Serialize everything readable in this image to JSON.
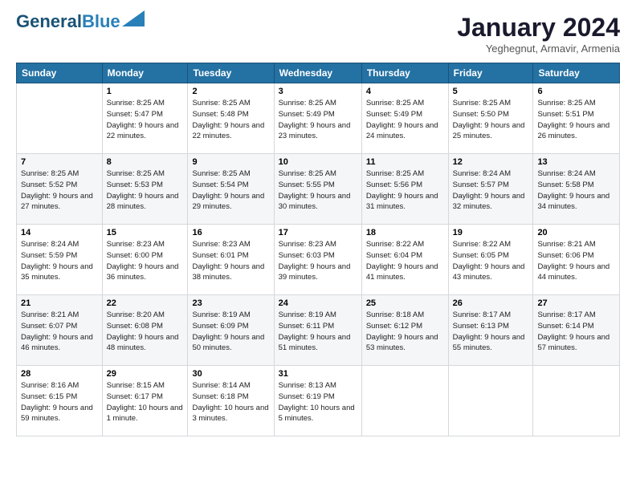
{
  "header": {
    "logo_line1": "General",
    "logo_line2": "Blue",
    "month": "January 2024",
    "location": "Yeghegnut, Armavir, Armenia"
  },
  "weekdays": [
    "Sunday",
    "Monday",
    "Tuesday",
    "Wednesday",
    "Thursday",
    "Friday",
    "Saturday"
  ],
  "weeks": [
    [
      {
        "day": "",
        "sunrise": "",
        "sunset": "",
        "daylight": ""
      },
      {
        "day": "1",
        "sunrise": "Sunrise: 8:25 AM",
        "sunset": "Sunset: 5:47 PM",
        "daylight": "Daylight: 9 hours and 22 minutes."
      },
      {
        "day": "2",
        "sunrise": "Sunrise: 8:25 AM",
        "sunset": "Sunset: 5:48 PM",
        "daylight": "Daylight: 9 hours and 22 minutes."
      },
      {
        "day": "3",
        "sunrise": "Sunrise: 8:25 AM",
        "sunset": "Sunset: 5:49 PM",
        "daylight": "Daylight: 9 hours and 23 minutes."
      },
      {
        "day": "4",
        "sunrise": "Sunrise: 8:25 AM",
        "sunset": "Sunset: 5:49 PM",
        "daylight": "Daylight: 9 hours and 24 minutes."
      },
      {
        "day": "5",
        "sunrise": "Sunrise: 8:25 AM",
        "sunset": "Sunset: 5:50 PM",
        "daylight": "Daylight: 9 hours and 25 minutes."
      },
      {
        "day": "6",
        "sunrise": "Sunrise: 8:25 AM",
        "sunset": "Sunset: 5:51 PM",
        "daylight": "Daylight: 9 hours and 26 minutes."
      }
    ],
    [
      {
        "day": "7",
        "sunrise": "Sunrise: 8:25 AM",
        "sunset": "Sunset: 5:52 PM",
        "daylight": "Daylight: 9 hours and 27 minutes."
      },
      {
        "day": "8",
        "sunrise": "Sunrise: 8:25 AM",
        "sunset": "Sunset: 5:53 PM",
        "daylight": "Daylight: 9 hours and 28 minutes."
      },
      {
        "day": "9",
        "sunrise": "Sunrise: 8:25 AM",
        "sunset": "Sunset: 5:54 PM",
        "daylight": "Daylight: 9 hours and 29 minutes."
      },
      {
        "day": "10",
        "sunrise": "Sunrise: 8:25 AM",
        "sunset": "Sunset: 5:55 PM",
        "daylight": "Daylight: 9 hours and 30 minutes."
      },
      {
        "day": "11",
        "sunrise": "Sunrise: 8:25 AM",
        "sunset": "Sunset: 5:56 PM",
        "daylight": "Daylight: 9 hours and 31 minutes."
      },
      {
        "day": "12",
        "sunrise": "Sunrise: 8:24 AM",
        "sunset": "Sunset: 5:57 PM",
        "daylight": "Daylight: 9 hours and 32 minutes."
      },
      {
        "day": "13",
        "sunrise": "Sunrise: 8:24 AM",
        "sunset": "Sunset: 5:58 PM",
        "daylight": "Daylight: 9 hours and 34 minutes."
      }
    ],
    [
      {
        "day": "14",
        "sunrise": "Sunrise: 8:24 AM",
        "sunset": "Sunset: 5:59 PM",
        "daylight": "Daylight: 9 hours and 35 minutes."
      },
      {
        "day": "15",
        "sunrise": "Sunrise: 8:23 AM",
        "sunset": "Sunset: 6:00 PM",
        "daylight": "Daylight: 9 hours and 36 minutes."
      },
      {
        "day": "16",
        "sunrise": "Sunrise: 8:23 AM",
        "sunset": "Sunset: 6:01 PM",
        "daylight": "Daylight: 9 hours and 38 minutes."
      },
      {
        "day": "17",
        "sunrise": "Sunrise: 8:23 AM",
        "sunset": "Sunset: 6:03 PM",
        "daylight": "Daylight: 9 hours and 39 minutes."
      },
      {
        "day": "18",
        "sunrise": "Sunrise: 8:22 AM",
        "sunset": "Sunset: 6:04 PM",
        "daylight": "Daylight: 9 hours and 41 minutes."
      },
      {
        "day": "19",
        "sunrise": "Sunrise: 8:22 AM",
        "sunset": "Sunset: 6:05 PM",
        "daylight": "Daylight: 9 hours and 43 minutes."
      },
      {
        "day": "20",
        "sunrise": "Sunrise: 8:21 AM",
        "sunset": "Sunset: 6:06 PM",
        "daylight": "Daylight: 9 hours and 44 minutes."
      }
    ],
    [
      {
        "day": "21",
        "sunrise": "Sunrise: 8:21 AM",
        "sunset": "Sunset: 6:07 PM",
        "daylight": "Daylight: 9 hours and 46 minutes."
      },
      {
        "day": "22",
        "sunrise": "Sunrise: 8:20 AM",
        "sunset": "Sunset: 6:08 PM",
        "daylight": "Daylight: 9 hours and 48 minutes."
      },
      {
        "day": "23",
        "sunrise": "Sunrise: 8:19 AM",
        "sunset": "Sunset: 6:09 PM",
        "daylight": "Daylight: 9 hours and 50 minutes."
      },
      {
        "day": "24",
        "sunrise": "Sunrise: 8:19 AM",
        "sunset": "Sunset: 6:11 PM",
        "daylight": "Daylight: 9 hours and 51 minutes."
      },
      {
        "day": "25",
        "sunrise": "Sunrise: 8:18 AM",
        "sunset": "Sunset: 6:12 PM",
        "daylight": "Daylight: 9 hours and 53 minutes."
      },
      {
        "day": "26",
        "sunrise": "Sunrise: 8:17 AM",
        "sunset": "Sunset: 6:13 PM",
        "daylight": "Daylight: 9 hours and 55 minutes."
      },
      {
        "day": "27",
        "sunrise": "Sunrise: 8:17 AM",
        "sunset": "Sunset: 6:14 PM",
        "daylight": "Daylight: 9 hours and 57 minutes."
      }
    ],
    [
      {
        "day": "28",
        "sunrise": "Sunrise: 8:16 AM",
        "sunset": "Sunset: 6:15 PM",
        "daylight": "Daylight: 9 hours and 59 minutes."
      },
      {
        "day": "29",
        "sunrise": "Sunrise: 8:15 AM",
        "sunset": "Sunset: 6:17 PM",
        "daylight": "Daylight: 10 hours and 1 minute."
      },
      {
        "day": "30",
        "sunrise": "Sunrise: 8:14 AM",
        "sunset": "Sunset: 6:18 PM",
        "daylight": "Daylight: 10 hours and 3 minutes."
      },
      {
        "day": "31",
        "sunrise": "Sunrise: 8:13 AM",
        "sunset": "Sunset: 6:19 PM",
        "daylight": "Daylight: 10 hours and 5 minutes."
      },
      {
        "day": "",
        "sunrise": "",
        "sunset": "",
        "daylight": ""
      },
      {
        "day": "",
        "sunrise": "",
        "sunset": "",
        "daylight": ""
      },
      {
        "day": "",
        "sunrise": "",
        "sunset": "",
        "daylight": ""
      }
    ]
  ]
}
